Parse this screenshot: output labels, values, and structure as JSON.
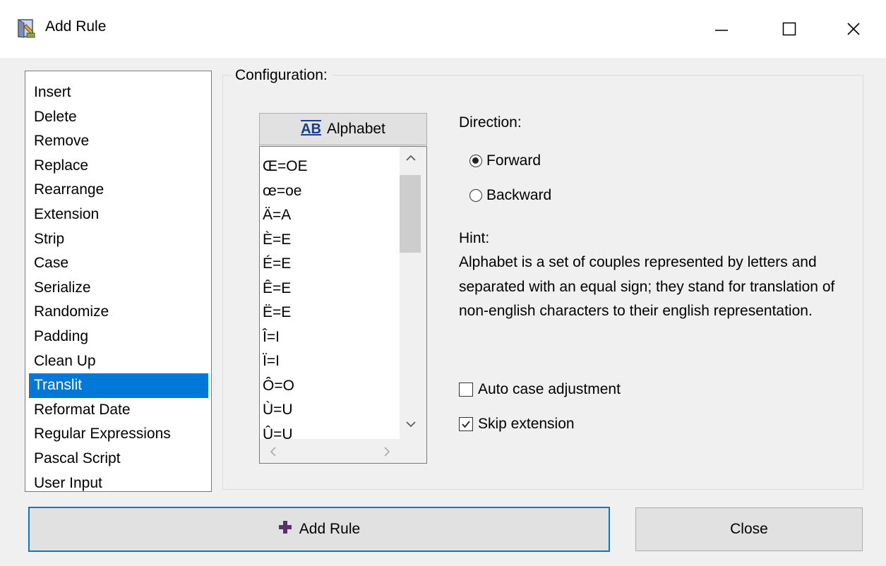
{
  "window": {
    "title": "Add Rule",
    "icons": {
      "app": "app-icon",
      "minimize": "minimize-icon",
      "maximize": "maximize-icon",
      "close": "close-icon"
    }
  },
  "rules": {
    "items": [
      "Insert",
      "Delete",
      "Remove",
      "Replace",
      "Rearrange",
      "Extension",
      "Strip",
      "Case",
      "Serialize",
      "Randomize",
      "Padding",
      "Clean Up",
      "Translit",
      "Reformat Date",
      "Regular Expressions",
      "Pascal Script",
      "User Input"
    ],
    "selected_index": 12
  },
  "config": {
    "group_label": "Configuration:",
    "alphabet_button": {
      "icon_text": "AB",
      "label": "Alphabet"
    },
    "alphabet_items": [
      "Œ=OE",
      "œ=oe",
      "Ä=A",
      "È=E",
      "É=E",
      "Ê=E",
      "Ë=E",
      "Î=I",
      "Ï=I",
      "Ô=O",
      "Ù=U",
      "Û=U"
    ],
    "direction_label": "Direction:",
    "direction_options": [
      {
        "label": "Forward",
        "checked": true
      },
      {
        "label": "Backward",
        "checked": false
      }
    ],
    "hint_label": "Hint:",
    "hint_text": "Alphabet is a set of couples represented by letters and separated with an equal sign; they stand for translation of non-english characters to their english representation.",
    "checkboxes": [
      {
        "label": "Auto case adjustment",
        "checked": false
      },
      {
        "label": "Skip extension",
        "checked": true
      }
    ]
  },
  "buttons": {
    "add_rule": "Add Rule",
    "close": "Close"
  },
  "colors": {
    "selection": "#0078d7",
    "focus_border": "#0078d7",
    "add_icon": "#5a2f6e"
  }
}
